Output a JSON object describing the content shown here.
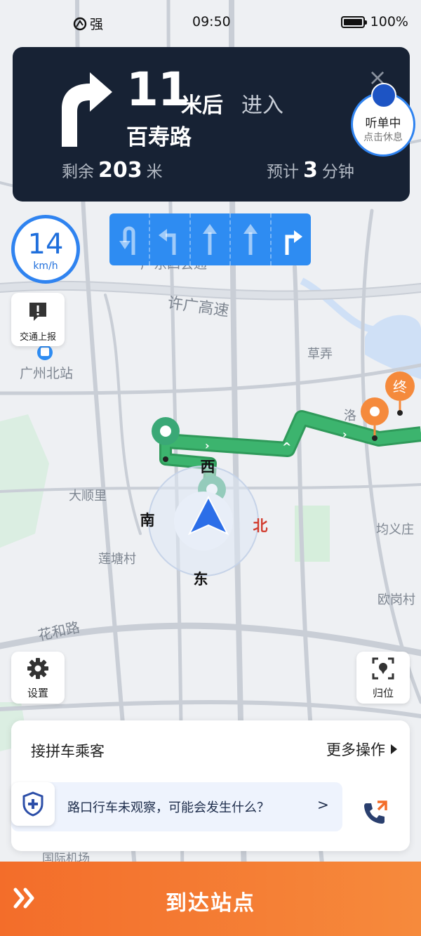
{
  "status_bar": {
    "signal_label": "强",
    "time": "09:50",
    "battery_text": "100%",
    "battery_level_pct": 100
  },
  "navigation": {
    "distance_value": "11",
    "distance_unit": "米后",
    "action": "进入",
    "road_name": "百寿路",
    "remaining_label": "剩余",
    "remaining_value": "203",
    "remaining_unit": "米",
    "eta_label": "预计",
    "eta_value": "3",
    "eta_unit": "分钟",
    "turn_icon": "turn-right-arrow"
  },
  "listening": {
    "line1": "听单中",
    "line2": "点击休息"
  },
  "speed": {
    "value": "14",
    "unit": "km/h"
  },
  "lanes": [
    "uturn-left",
    "turn-left",
    "straight",
    "straight",
    "turn-right"
  ],
  "map": {
    "labels": [
      "广东四会通",
      "许广高速",
      "草弄",
      "广州北站",
      "洛",
      "大顺里",
      "莲塘村",
      "均义庄",
      "欧岗村",
      "花和路",
      "国际机场"
    ],
    "compass": {
      "west": "西",
      "south": "南",
      "north": "北",
      "east": "东"
    },
    "end_marker": "终",
    "route_color": "#3cb46e",
    "accent_color": "#2e8cf2"
  },
  "buttons": {
    "report": "交通上报",
    "settings": "设置",
    "locate": "归位"
  },
  "panel": {
    "pickup_label": "接拼车乘客",
    "more_ops": "更多操作",
    "safety_tip": "路口行车未观察，可能会发生什么？",
    "safety_chevron": ">"
  },
  "arrive_button": "到达站点",
  "colors": {
    "nav_card_bg": "#172234",
    "arrive_bar": "#f36d2a"
  }
}
